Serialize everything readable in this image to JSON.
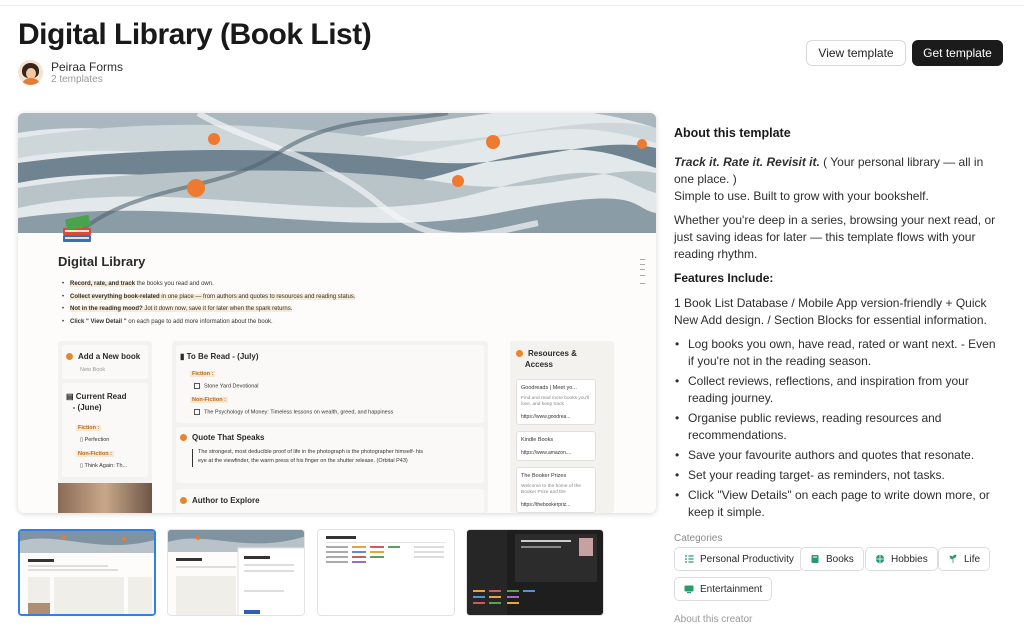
{
  "page": {
    "title": "Digital Library (Book List)",
    "creator_name": "Peiraa Forms",
    "creator_templates": "2 templates",
    "view_button": "View template",
    "get_button": "Get template"
  },
  "preview": {
    "title": "Digital Library",
    "bullets": [
      {
        "strong": "Record, rate, and track",
        "rest": " the books you read and own."
      },
      {
        "strong": "Collect everything book-related",
        "rest": " in one place — from authors and quotes to resources and reading status."
      },
      {
        "strong": "Not in the reading mood?",
        "rest": " Jot it down now, save it for later when the spark returns."
      },
      {
        "strong": "Click \" View Detail \"",
        "rest": " on each page to add more information about the book."
      }
    ],
    "add_new_book": "Add a New book",
    "new_book_btn": "New Book",
    "current_read": "Current Read",
    "current_read_sub": "- (June)",
    "fiction_label": "Fiction :",
    "nonfiction_label": "Non-Fiction :",
    "current_fiction": "Perfection",
    "current_nonfiction": "Think Again: Th...",
    "to_be_read": "To Be Read - (July)",
    "tbr_fiction": "Stone Yard Devotional",
    "tbr_nonfiction": "The Psychology of Money: Timeless lessons on wealth, greed, and happiness",
    "quote_heading": "Quote That Speaks",
    "quote_text_1": "The strongest, most deducible proof of life in the photograph is the photographer himself- his",
    "quote_text_2": "eye at the viewfinder, the warm press of his finger on the shutter release. (Orbital P43)",
    "author_heading": "Author to Explore",
    "resources_heading": "Resources &",
    "resources_heading_2": "Access",
    "res_cards": [
      {
        "title": "Goodreads | Meet yo...",
        "desc": "Find and read more books you'll love, and keep track",
        "url": "https://www.goodrea..."
      },
      {
        "title": "Kindle Books",
        "desc": "",
        "url": "https://www.amazon...."
      },
      {
        "title": "The Booker Prizes",
        "desc": "Welcome to the home of the Booker Prize and the",
        "url": "https://thebookerpriz..."
      }
    ]
  },
  "about": {
    "heading": "About this template",
    "tagline": "Track it. Rate it. Revisit it.",
    "tagline_rest": " ( Your personal library — all in one place. )",
    "line2": "Simple to use. Built to grow with your bookshelf.",
    "para2": "Whether you're deep in a series, browsing your next read, or just saving ideas for later — this template flows with your reading rhythm.",
    "features_heading": "Features Include:",
    "features_intro": "1 Book List Database / Mobile App version-friendly + Quick New Add design. / Section Blocks for essential information.",
    "features": [
      "Log books you own, have read, rated or want next. - Even if you're not in the reading season.",
      "Collect reviews, reflections, and inspiration from your reading journey.",
      "Organise public reviews, reading resources and recommendations.",
      "Save your favourite authors and quotes that resonate.",
      "Set your reading target- as reminders, not tasks.",
      "Click \"View Details\" on each page to write down more, or keep it simple."
    ],
    "categories_heading": "Categories",
    "categories": [
      "Personal Productivity",
      "Books",
      "Hobbies",
      "Life",
      "Entertainment"
    ],
    "about_creator": "About this creator"
  },
  "thumbnails": [
    {
      "name": "thumbnail-1",
      "active": true
    },
    {
      "name": "thumbnail-2",
      "active": false
    },
    {
      "name": "thumbnail-3",
      "active": false
    },
    {
      "name": "thumbnail-4",
      "active": false
    }
  ],
  "colors": {
    "accent_orange": "#e4872f",
    "primary_button": "#1b1b1b",
    "active_thumb_border": "#2f80ed"
  }
}
